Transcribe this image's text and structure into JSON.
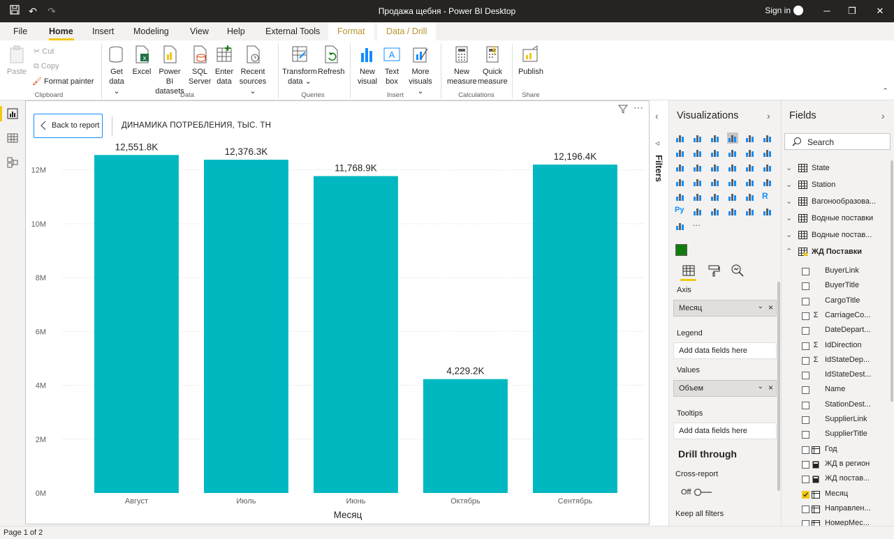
{
  "window": {
    "title": "Продажа щебня - Power BI Desktop",
    "sign_in": "Sign in"
  },
  "menu": {
    "file": "File",
    "home": "Home",
    "insert": "Insert",
    "modeling": "Modeling",
    "view": "View",
    "help": "Help",
    "external_tools": "External Tools",
    "format": "Format",
    "data_drill": "Data / Drill"
  },
  "ribbon": {
    "clipboard": {
      "paste": "Paste",
      "cut": "Cut",
      "copy": "Copy",
      "format_painter": "Format painter",
      "label": "Clipboard"
    },
    "data": {
      "get_data_1": "Get",
      "get_data_2": "data",
      "excel": "Excel",
      "pbi_1": "Power BI",
      "pbi_2": "datasets",
      "sql_1": "SQL",
      "sql_2": "Server",
      "enter_1": "Enter",
      "enter_2": "data",
      "recent_1": "Recent",
      "recent_2": "sources",
      "label": "Data"
    },
    "queries": {
      "transform_1": "Transform",
      "transform_2": "data",
      "refresh": "Refresh",
      "label": "Queries"
    },
    "insert": {
      "new_visual_1": "New",
      "new_visual_2": "visual",
      "text_box_1": "Text",
      "text_box_2": "box",
      "more_visuals_1": "More",
      "more_visuals_2": "visuals",
      "label": "Insert"
    },
    "calculations": {
      "new_measure_1": "New",
      "new_measure_2": "measure",
      "quick_measure_1": "Quick",
      "quick_measure_2": "measure",
      "label": "Calculations"
    },
    "share": {
      "publish": "Publish",
      "label": "Share"
    }
  },
  "canvas": {
    "back_to_report": "Back to report",
    "visual_title": "ДИНАМИКА ПОТРЕБЛЕНИЯ, ТЫС. ТН"
  },
  "chart_data": {
    "type": "bar",
    "categories": [
      "Август",
      "Июль",
      "Июнь",
      "Октябрь",
      "Сентябрь"
    ],
    "values": [
      12551.8,
      12376.3,
      11768.9,
      4229.2,
      12196.4
    ],
    "data_labels": [
      "12,551.8K",
      "12,376.3K",
      "11,768.9K",
      "4,229.2K",
      "12,196.4K"
    ],
    "y_ticks": [
      0,
      2,
      4,
      6,
      8,
      10,
      12
    ],
    "y_tick_labels": [
      "0M",
      "2M",
      "4M",
      "6M",
      "8M",
      "10M",
      "12M"
    ],
    "ylim": [
      0,
      13000
    ],
    "xlabel": "Месяц",
    "ylabel": "",
    "bar_color": "#01b8c1",
    "grid": true
  },
  "filters_pane": {
    "label": "Filters"
  },
  "visualizations": {
    "title": "Visualizations",
    "axis_label": "Axis",
    "axis_field": "Месяц",
    "legend_label": "Legend",
    "legend_placeholder": "Add data fields here",
    "values_label": "Values",
    "values_field": "Объем",
    "tooltips_label": "Tooltips",
    "tooltips_placeholder": "Add data fields here",
    "drill_through": "Drill through",
    "cross_report": "Cross-report",
    "off": "Off",
    "keep_all_filters": "Keep all filters"
  },
  "fields": {
    "title": "Fields",
    "search_placeholder": "Search",
    "tables": [
      {
        "name": "State",
        "expanded": false
      },
      {
        "name": "Station",
        "expanded": false
      },
      {
        "name": "Вагонообразова...",
        "expanded": false
      },
      {
        "name": "Водные поставки",
        "expanded": false
      },
      {
        "name": "Водные постав...",
        "expanded": false
      },
      {
        "name": "ЖД Поставки",
        "expanded": true
      }
    ],
    "items": [
      {
        "name": "BuyerLink",
        "type": "",
        "checked": false
      },
      {
        "name": "BuyerTitle",
        "type": "",
        "checked": false
      },
      {
        "name": "CargoTitle",
        "type": "",
        "checked": false
      },
      {
        "name": "CarriageCo...",
        "type": "Σ",
        "checked": false
      },
      {
        "name": "DateDepart...",
        "type": "",
        "checked": false
      },
      {
        "name": "IdDirection",
        "type": "Σ",
        "checked": false
      },
      {
        "name": "IdStateDep...",
        "type": "Σ",
        "checked": false
      },
      {
        "name": "IdStateDest...",
        "type": "",
        "checked": false
      },
      {
        "name": "Name",
        "type": "",
        "checked": false
      },
      {
        "name": "StationDest...",
        "type": "",
        "checked": false
      },
      {
        "name": "SupplierLink",
        "type": "",
        "checked": false
      },
      {
        "name": "SupplierTitle",
        "type": "",
        "checked": false
      },
      {
        "name": "Год",
        "type": "hier",
        "checked": false
      },
      {
        "name": "ЖД в регион",
        "type": "calc",
        "checked": false
      },
      {
        "name": "ЖД постав...",
        "type": "calc",
        "checked": false
      },
      {
        "name": "Месяц",
        "type": "hier",
        "checked": true
      },
      {
        "name": "Направлен...",
        "type": "hier",
        "checked": false
      },
      {
        "name": "НомерМес...",
        "type": "hier",
        "checked": false
      }
    ]
  },
  "status": {
    "page": "Page 1 of 2"
  }
}
